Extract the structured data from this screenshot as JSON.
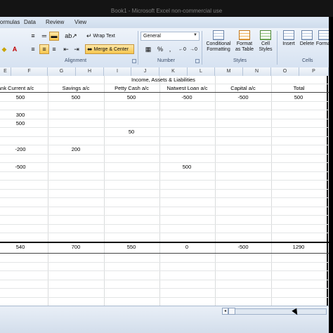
{
  "window": {
    "title": "Book1 - Microsoft Excel non-commercial use"
  },
  "tabs": [
    "Formulas",
    "Data",
    "Review",
    "View"
  ],
  "ribbon": {
    "wrap_text_label": "Wrap Text",
    "merge_center_label": "Merge & Center",
    "number_format_value": "General",
    "percent_glyph": "%",
    "comma_glyph": ",",
    "conditional_formatting_label": "Conditional Formatting",
    "format_as_table_label": "Format as Table",
    "cell_styles_label": "Cell Styles",
    "insert_label": "Insert",
    "delete_label": "Delete",
    "format_label": "Format",
    "groups": {
      "alignment": "Alignment",
      "number": "Number",
      "styles": "Styles",
      "cells": "Cells"
    }
  },
  "columns": [
    "E",
    "F",
    "G",
    "H",
    "I",
    "J",
    "K",
    "L",
    "M",
    "N",
    "O",
    "P"
  ],
  "sheet": {
    "heading": "Income, Assets & Liabilities",
    "headers": [
      "ank Current a/c",
      "Savings a/c",
      "Petty Cash a/c",
      "Natwest Loan a/c",
      "Capital a/c",
      "Total"
    ],
    "rows": [
      [
        "500",
        "500",
        "500",
        "-500",
        "-500",
        "500"
      ],
      [
        "300",
        "",
        "",
        "",
        "",
        ""
      ],
      [
        "500",
        "",
        "",
        "",
        "",
        ""
      ],
      [
        "",
        "",
        "50",
        "",
        "",
        ""
      ],
      [
        "-200",
        "200",
        "",
        "",
        "",
        ""
      ],
      [
        "-500",
        "",
        "",
        "500",
        "",
        ""
      ]
    ],
    "totals": [
      "540",
      "700",
      "550",
      "0",
      "-500",
      "1290"
    ]
  },
  "colors": {
    "ribbon": "#dce6f2",
    "active_button": "#f7c64d",
    "grid_line": "#dadcdd"
  }
}
